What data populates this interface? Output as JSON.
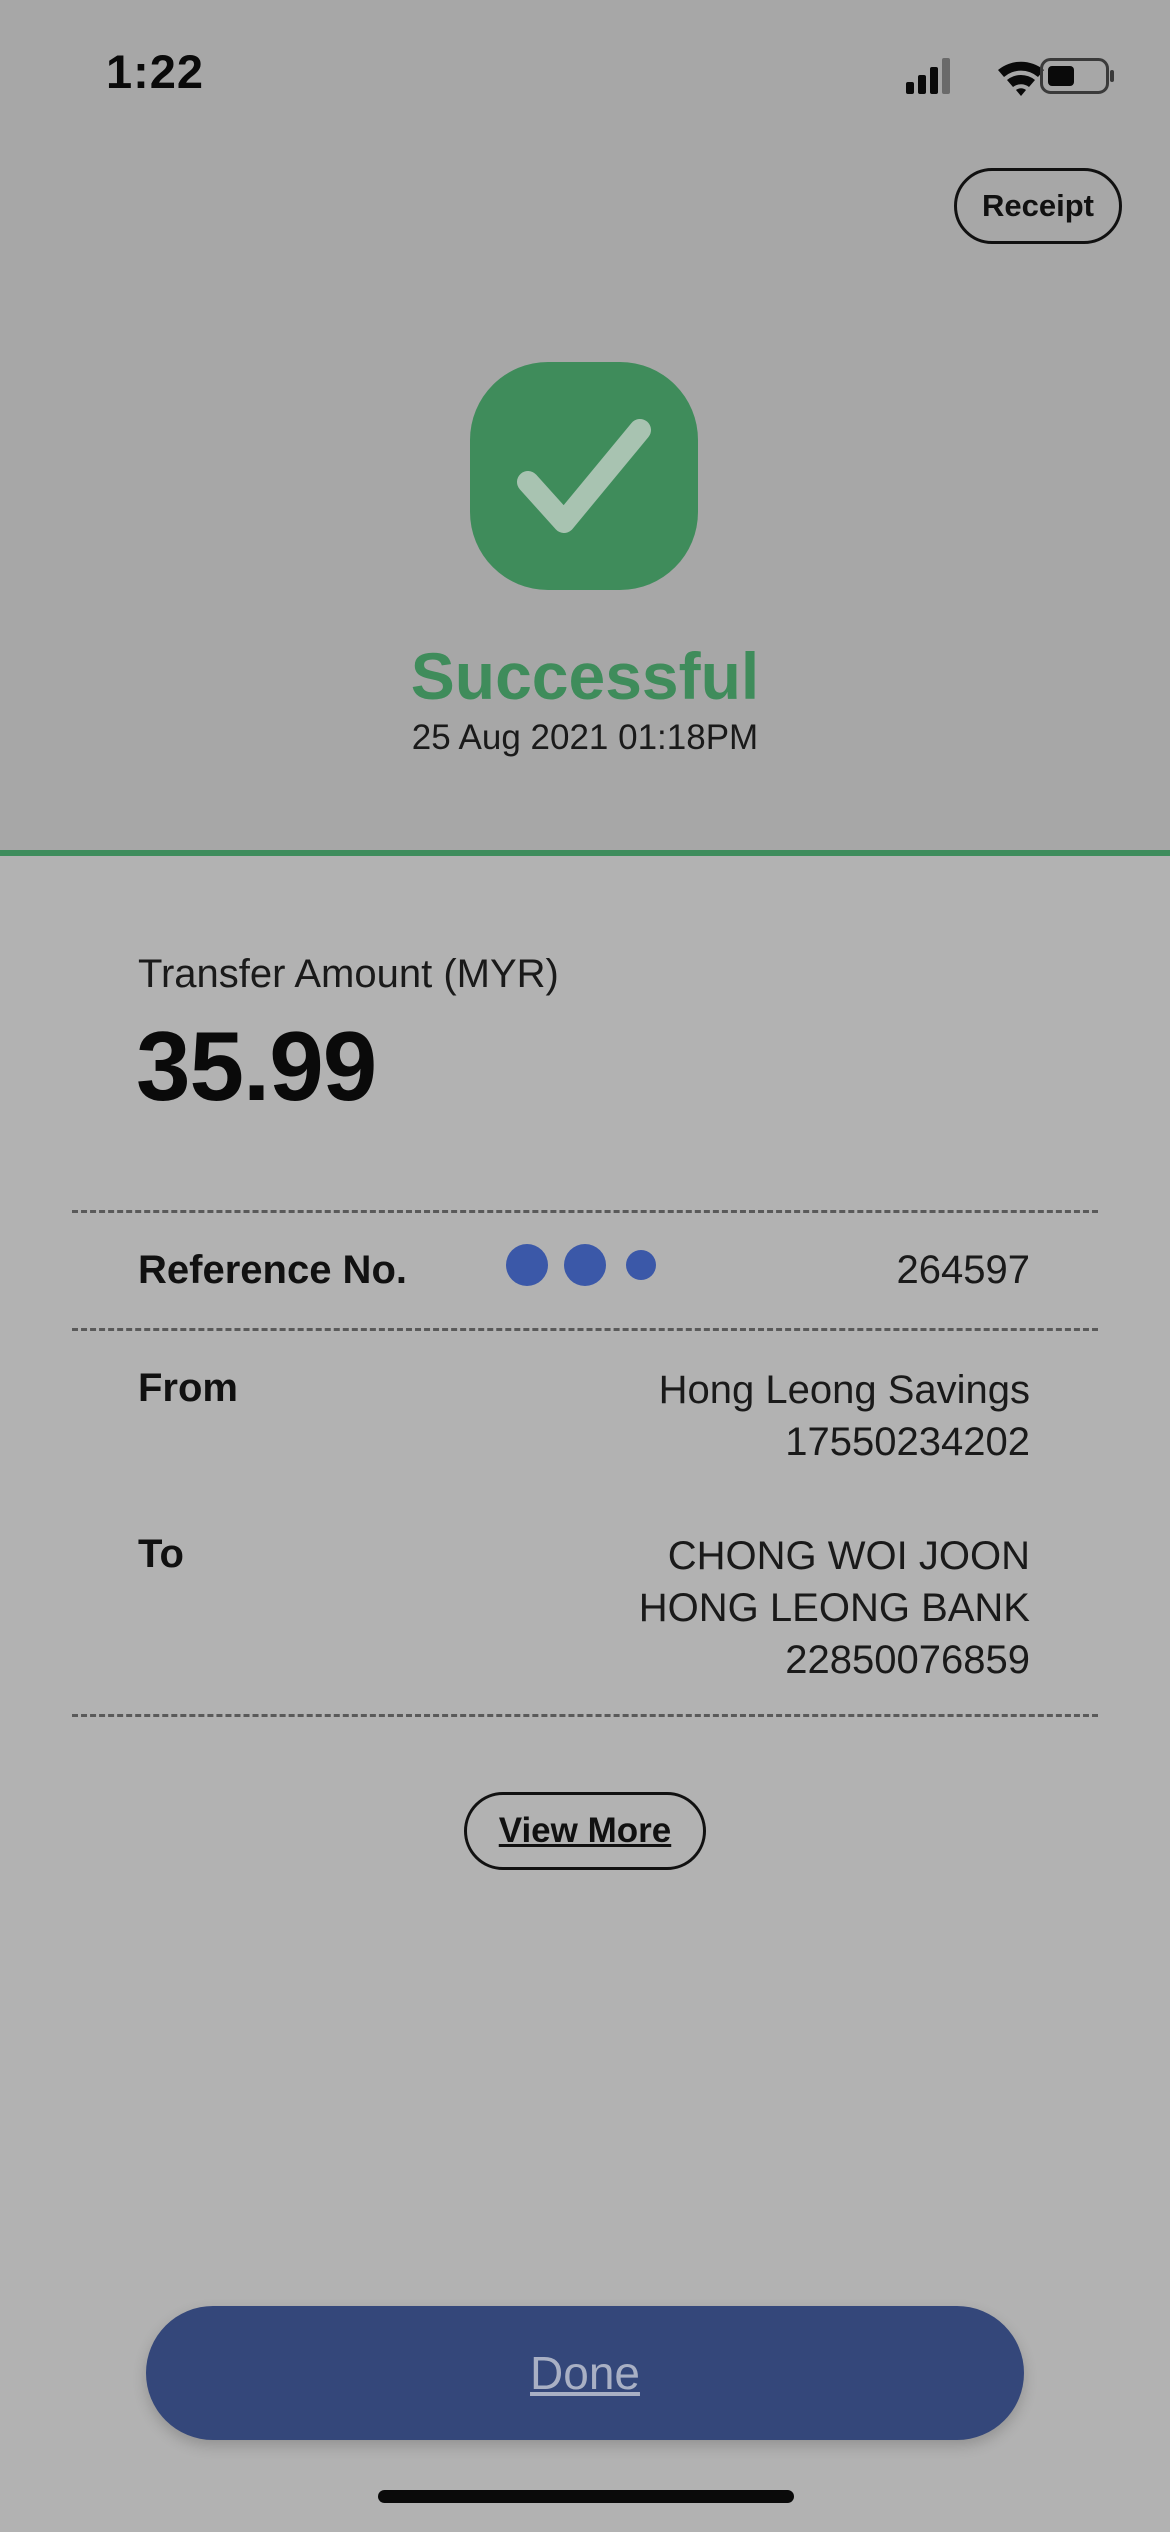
{
  "status_bar": {
    "time": "1:22"
  },
  "header": {
    "receipt_label": "Receipt"
  },
  "result": {
    "status": "Successful",
    "datetime": "25 Aug 2021 01:18PM"
  },
  "transfer": {
    "amount_label": "Transfer Amount (MYR)",
    "amount": "35.99"
  },
  "details": {
    "reference_label": "Reference No.",
    "reference_value": "264597",
    "from_label": "From",
    "from_line1": "Hong Leong Savings",
    "from_line2": "17550234202",
    "to_label": "To",
    "to_line1": "CHONG WOI JOON",
    "to_line2": "HONG LEONG BANK",
    "to_line3": "22850076859"
  },
  "actions": {
    "view_more_label": "View More",
    "done_label": "Done"
  },
  "colors": {
    "success_green": "#3f8c5b",
    "primary_blue": "#34477a",
    "loading_dot_blue": "#3b58a8"
  },
  "icons": {
    "status_check": "checkmark-icon",
    "signal": "cellular-signal-icon",
    "wifi": "wifi-icon",
    "battery": "battery-icon"
  }
}
